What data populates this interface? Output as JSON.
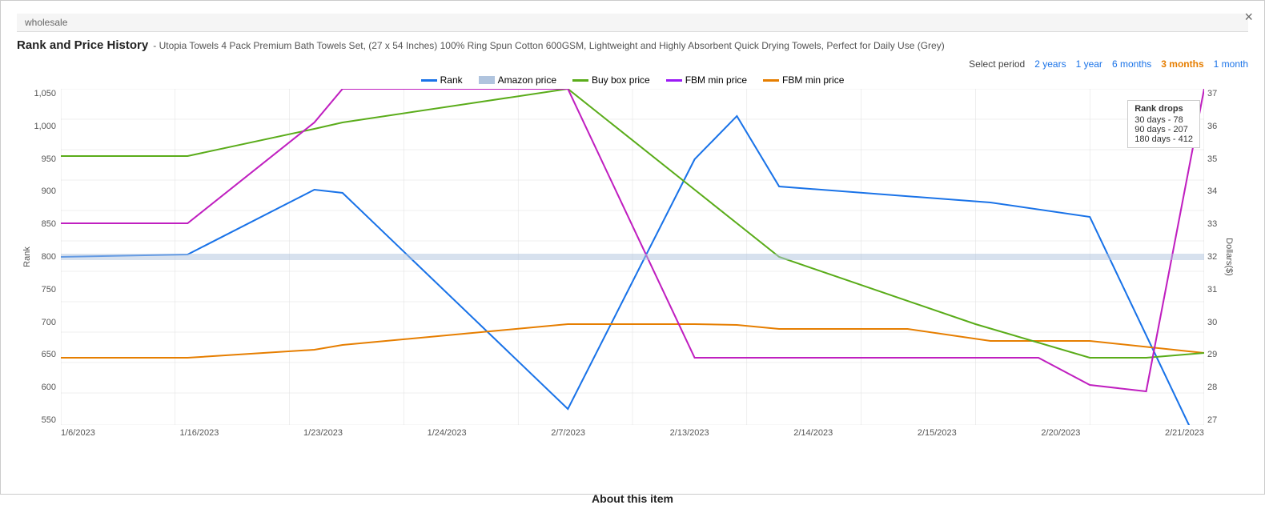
{
  "modal": {
    "title": "Rank and Price History",
    "subtitle": "- Utopia Towels 4 Pack Premium Bath Towels Set, (27 x 54 Inches) 100% Ring Spun Cotton 600GSM, Lightweight and Highly Absorbent Quick Drying Towels, Perfect for Daily Use (Grey)",
    "close_label": "×"
  },
  "period_selector": {
    "label": "Select period",
    "options": [
      {
        "label": "2 years",
        "active": false
      },
      {
        "label": "1 year",
        "active": false
      },
      {
        "label": "6 months",
        "active": false
      },
      {
        "label": "3 months",
        "active": true
      },
      {
        "label": "1 month",
        "active": false
      }
    ]
  },
  "legend": {
    "items": [
      {
        "label": "Rank",
        "color_class": "rank"
      },
      {
        "label": "Amazon price",
        "color_class": "amazon"
      },
      {
        "label": "Buy box price",
        "color_class": "buybox"
      },
      {
        "label": "FBM min price",
        "color_class": "fbm-min"
      },
      {
        "label": "FBM min price",
        "color_class": "fbm-min-price"
      }
    ]
  },
  "rank_drops": {
    "title": "Rank drops",
    "items": [
      {
        "label": "30 days - 78"
      },
      {
        "label": "90 days - 207"
      },
      {
        "label": "180 days - 412"
      }
    ]
  },
  "y_axis_left": {
    "label": "Rank",
    "values": [
      "1,050",
      "1,000",
      "950",
      "900",
      "850",
      "800",
      "750",
      "700",
      "650",
      "600",
      "550"
    ]
  },
  "y_axis_right": {
    "label": "Dollars($)",
    "values": [
      "37",
      "36",
      "35",
      "34",
      "33",
      "32",
      "31",
      "30",
      "29",
      "28",
      "27"
    ]
  },
  "x_axis": {
    "labels": [
      "1/6/2023",
      "1/16/2023",
      "1/23/2023",
      "1/24/2023",
      "2/7/2023",
      "2/13/2023",
      "2/14/2023",
      "2/15/2023",
      "2/20/2023",
      "2/21/2023"
    ]
  },
  "about": {
    "label": "About this item"
  },
  "top_bar": {
    "text": "wholesale"
  }
}
